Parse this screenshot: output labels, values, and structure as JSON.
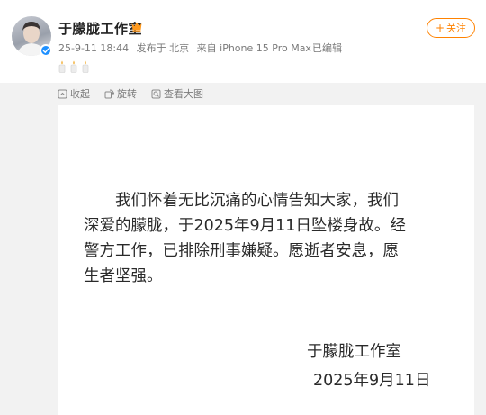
{
  "post": {
    "username": "于朦胧工作室",
    "timestamp": "25-9-11 18:44",
    "location": "发布于 北京",
    "device": "来自 iPhone 15 Pro Max",
    "edited": "已编辑",
    "follow_label": "关注",
    "follow_plus": "+",
    "candle_count": 3
  },
  "toolbar": {
    "collapse_label": "收起",
    "rotate_label": "旋转",
    "view_large_label": "查看大图"
  },
  "statement": {
    "line1": "我们怀着无比沉痛的心情告知大家，我们",
    "line2": "深爱的朦胧，于2025年9月11日坠楼身故。经",
    "line3": "警方工作，已排除刑事嫌疑。愿逝者安息，愿",
    "line4": "生者坚强。",
    "signature": "于朦胧工作室",
    "date": "2025年9月11日"
  },
  "colors": {
    "accent": "#ff8200",
    "verified": "#1e90ff",
    "panel_bg": "#f2f2f2"
  },
  "icons": [
    "verified-icon",
    "crown-icon",
    "candle-icon",
    "collapse-icon",
    "rotate-icon",
    "view-large-icon"
  ]
}
